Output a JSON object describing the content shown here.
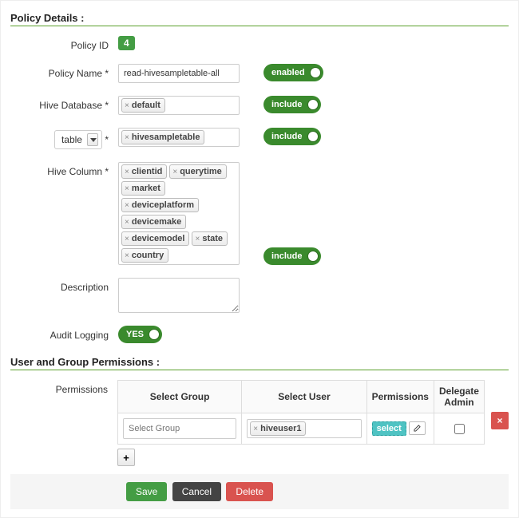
{
  "sections": {
    "policy_details": "Policy Details :",
    "user_group_perms": "User and Group Permissions :"
  },
  "labels": {
    "policy_id": "Policy ID",
    "policy_name": "Policy Name *",
    "hive_db": "Hive Database *",
    "table_star": "*",
    "hive_col": "Hive Column *",
    "description": "Description",
    "audit_logging": "Audit Logging",
    "permissions": "Permissions"
  },
  "values": {
    "policy_id": "4",
    "policy_name": "read-hivesampletable-all",
    "table_select": "table",
    "description": ""
  },
  "tokens": {
    "hive_db": [
      "default"
    ],
    "table": [
      "hivesampletable"
    ],
    "hive_cols": [
      "clientid",
      "querytime",
      "market",
      "deviceplatform",
      "devicemake",
      "devicemodel",
      "state",
      "country"
    ]
  },
  "toggles": {
    "enabled": "enabled",
    "include1": "include",
    "include2": "include",
    "include3": "include",
    "yes": "YES"
  },
  "perm_table": {
    "headers": [
      "Select Group",
      "Select User",
      "Permissions",
      "Delegate Admin"
    ],
    "group_placeholder": "Select Group",
    "user_tokens": [
      "hiveuser1"
    ],
    "perm_tag": "select"
  },
  "buttons": {
    "save": "Save",
    "cancel": "Cancel",
    "delete": "Delete",
    "add": "+",
    "remove": "×"
  }
}
